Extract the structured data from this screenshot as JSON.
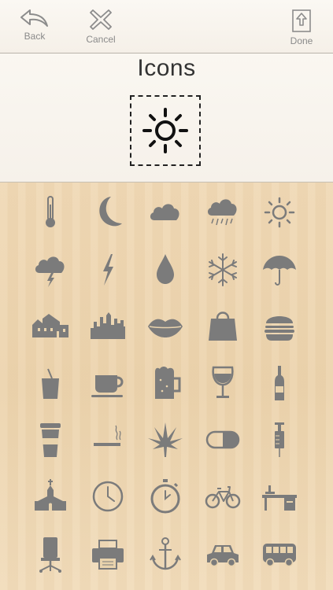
{
  "toolbar": {
    "back_label": "Back",
    "cancel_label": "Cancel",
    "done_label": "Done"
  },
  "preview": {
    "title": "Icons",
    "selected_icon": "sun-icon"
  },
  "colors": {
    "icon_gray": "#7b7b7b",
    "header_bg": "#f8f4ee",
    "wood": "#efd8b4"
  },
  "icons": [
    [
      "thermometer-icon",
      "moon-icon",
      "cloud-icon",
      "rain-cloud-icon",
      "sun-icon"
    ],
    [
      "storm-cloud-icon",
      "lightning-icon",
      "drop-icon",
      "snowflake-icon",
      "umbrella-icon"
    ],
    [
      "house-icon",
      "city-skyline-icon",
      "lips-icon",
      "shopping-bag-icon",
      "burger-icon"
    ],
    [
      "drink-cup-icon",
      "coffee-cup-icon",
      "beer-mug-icon",
      "wine-glass-icon",
      "bottle-icon"
    ],
    [
      "takeaway-cup-icon",
      "cigarette-icon",
      "cannabis-leaf-icon",
      "pill-icon",
      "syringe-icon"
    ],
    [
      "church-icon",
      "clock-icon",
      "stopwatch-icon",
      "bicycle-icon",
      "desk-icon"
    ],
    [
      "office-chair-icon",
      "printer-icon",
      "anchor-icon",
      "car-icon",
      "bus-icon"
    ]
  ]
}
